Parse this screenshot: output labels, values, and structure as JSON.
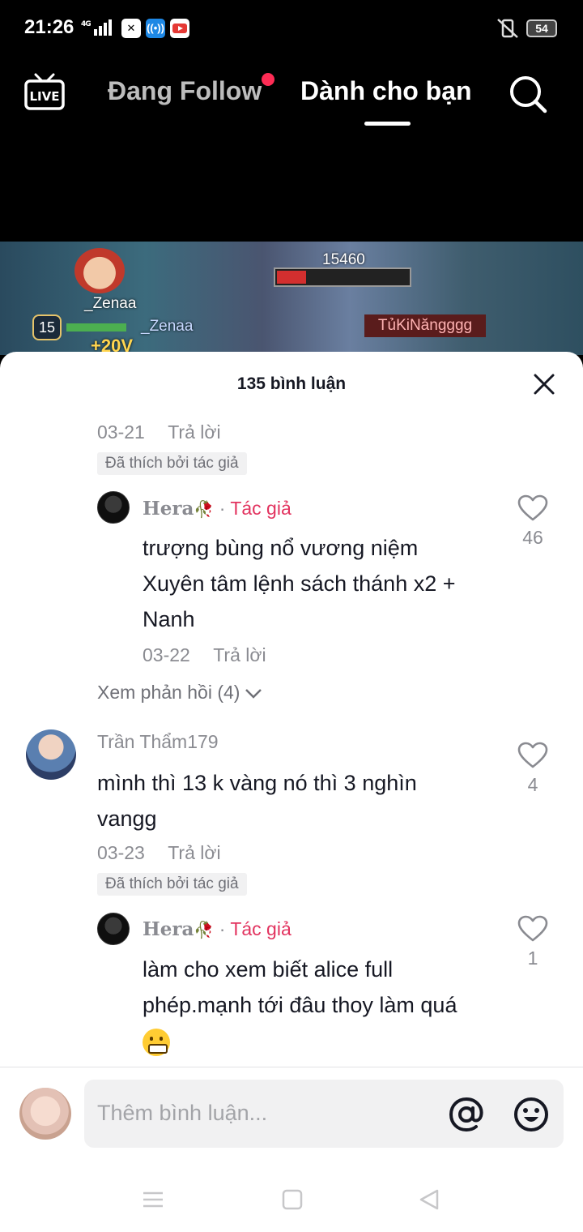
{
  "status_bar": {
    "time": "21:26",
    "network": "4G",
    "battery": "54"
  },
  "top_nav": {
    "live_label": "LIVE",
    "following_tab": "Đang Follow",
    "for_you_tab": "Dành cho bạn"
  },
  "video": {
    "player_name": "_Zenaa",
    "player_name_bar": "_Zenaa",
    "level": "15",
    "gold": "+20V",
    "boss_hp": "15460",
    "enemy_name": "TủKiNăngggg"
  },
  "comments_sheet": {
    "title": "135 bình luận",
    "prev_meta": {
      "date": "03-21",
      "reply": "Trả lời",
      "liked_by_author": "Đã thích bởi tác giả"
    },
    "reply1": {
      "user": "Hera",
      "author_tag": "Tác giả",
      "text_line1": "trượng bùng nổ vương niệm",
      "text_line2": "Xuyên tâm lệnh sách thánh x2 +",
      "text_line3": "Nanh",
      "date": "03-22",
      "reply": "Trả lời",
      "likes": "46"
    },
    "view_replies": "Xem phản hồi (4)",
    "comment2": {
      "user": "Trần Thẩm179",
      "text_line1": "mình thì 13 k vàng nó thì 3 nghìn",
      "text_line2": "vangg",
      "date": "03-23",
      "reply": "Trả lời",
      "likes": "4",
      "liked_by_author": "Đã thích bởi tác giả"
    },
    "reply2": {
      "user": "Hera",
      "author_tag": "Tác giả",
      "text_line1": "làm cho xem biết alice full",
      "text_line2": "phép.mạnh tới đâu thoy làm quá",
      "likes": "1"
    },
    "input_placeholder": "Thêm bình luận..."
  },
  "colors": {
    "accent_red": "#fe2c55",
    "author_tag": "#e2335f",
    "muted_text": "#8a8b91"
  }
}
